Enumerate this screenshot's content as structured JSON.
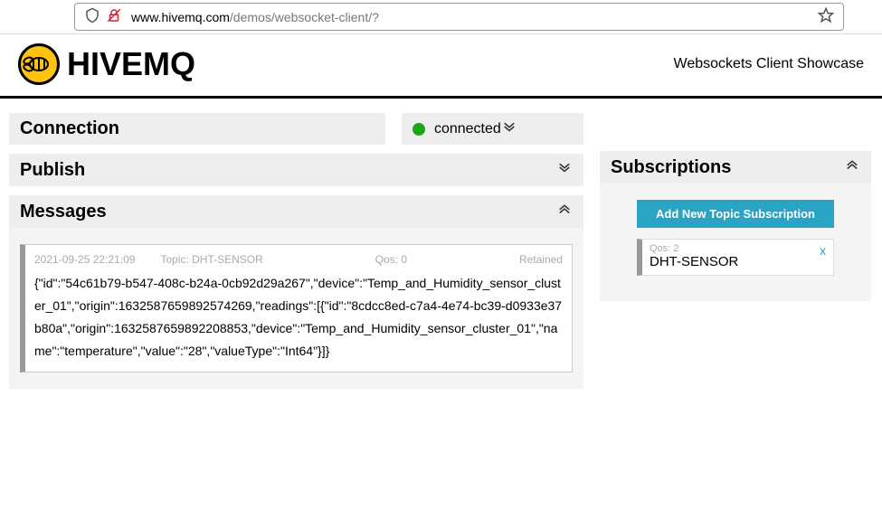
{
  "browser": {
    "url_host": "www.hivemq.com",
    "url_path": "/demos/websocket-client/?"
  },
  "header": {
    "brand": "HIVEMQ",
    "showcase": "Websockets Client Showcase"
  },
  "connection": {
    "title": "Connection",
    "status_text": "connected"
  },
  "publish": {
    "title": "Publish"
  },
  "messages": {
    "title": "Messages",
    "items": [
      {
        "timestamp": "2021-09-25 22:21:09",
        "topic_label": "Topic: DHT-SENSOR",
        "qos_label": "Qos: 0",
        "retained_label": "Retained",
        "payload": "{\"id\":\"54c61b79-b547-408c-b24a-0cb92d29a267\",\"device\":\"Temp_and_Humidity_sensor_cluster_01\",\"origin\":1632587659892574269,\"readings\":[{\"id\":\"8cdcc8ed-c7a4-4e74-bc39-d0933e37b80a\",\"origin\":1632587659892208853,\"device\":\"Temp_and_Humidity_sensor_cluster_01\",\"name\":\"temperature\",\"value\":\"28\",\"valueType\":\"Int64\"}]}"
      }
    ]
  },
  "subscriptions": {
    "title": "Subscriptions",
    "add_button_label": "Add New Topic Subscription",
    "items": [
      {
        "qos_label": "Qos: 2",
        "topic": "DHT-SENSOR",
        "close": "x"
      }
    ]
  }
}
